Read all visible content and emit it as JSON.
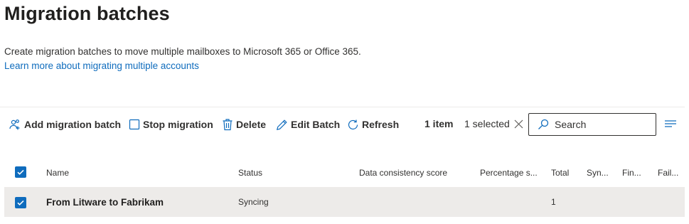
{
  "page": {
    "title": "Migration batches",
    "description": "Create migration batches to move multiple mailboxes to Microsoft 365 or Office 365.",
    "learn_more": "Learn more about migrating multiple accounts"
  },
  "toolbar": {
    "add_label": "Add migration batch",
    "stop_label": "Stop migration",
    "delete_label": "Delete",
    "edit_label": "Edit Batch",
    "refresh_label": "Refresh",
    "item_count": "1 item",
    "selected_count": "1 selected",
    "search_placeholder": "Search",
    "icons": [
      "add-people-icon",
      "stop-square-icon",
      "trash-icon",
      "pencil-icon",
      "refresh-icon",
      "close-icon",
      "search-icon",
      "lines-icon"
    ]
  },
  "table": {
    "columns": [
      "Name",
      "Status",
      "Data consistency score",
      "Percentage s...",
      "Total",
      "Syn...",
      "Fin...",
      "Fail..."
    ],
    "rows": [
      {
        "selected": true,
        "name": "From Litware to Fabrikam",
        "status": "Syncing",
        "data_consistency": "",
        "percentage": "",
        "total": "1",
        "synced": "",
        "finalized": "",
        "failed": ""
      }
    ]
  },
  "colors": {
    "accent": "#0f6cbd",
    "selected_row": "#edebe9",
    "text": "#323130"
  }
}
